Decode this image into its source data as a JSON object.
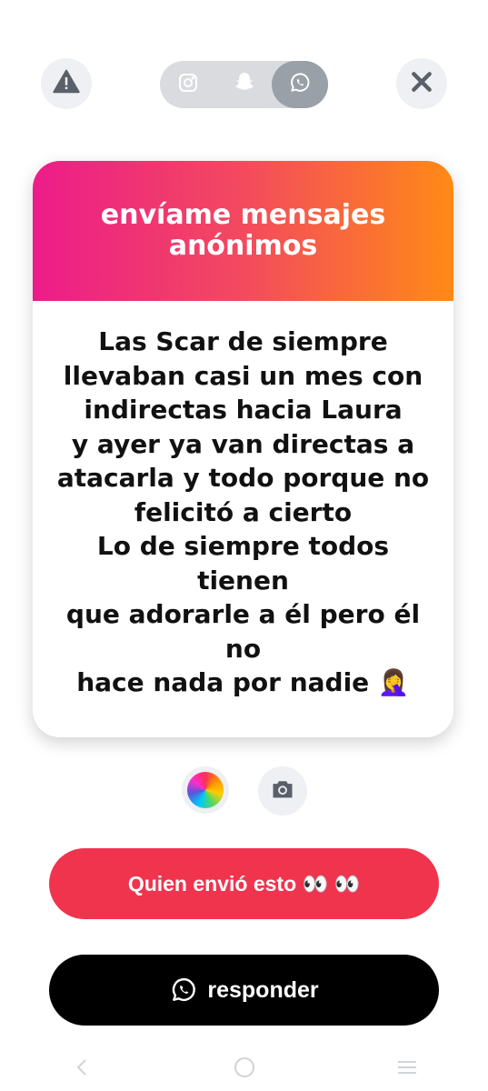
{
  "top_bar": {
    "report_icon": "warning-icon",
    "close_icon": "close-icon",
    "share_options": [
      {
        "icon": "instagram-icon",
        "active": false
      },
      {
        "icon": "snapchat-icon",
        "active": false
      },
      {
        "icon": "whatsapp-icon",
        "active": true
      }
    ]
  },
  "card": {
    "header": "envíame mensajes anónimos",
    "message": "Las Scar de siempre\nllevaban casi un mes con\nindirectas hacia Laura\ny ayer ya van directas a\natacarla y todo porque no\nfelicitó a cierto\nLo de siempre todos tienen\nque adorarle a él pero él no\nhace nada por nadie 🤦‍♀️",
    "gradient": [
      "#ec1c8a",
      "#ff8a16"
    ]
  },
  "tools": {
    "color_icon": "color-wheel-icon",
    "camera_icon": "camera-icon"
  },
  "buttons": {
    "who_sent": "Quien envió esto 👀 👀",
    "reply": "responder",
    "who_sent_color": "#f0344e",
    "reply_color": "#000000"
  },
  "navbar": {
    "icons": [
      "back-icon",
      "home-icon",
      "menu-icon"
    ]
  }
}
